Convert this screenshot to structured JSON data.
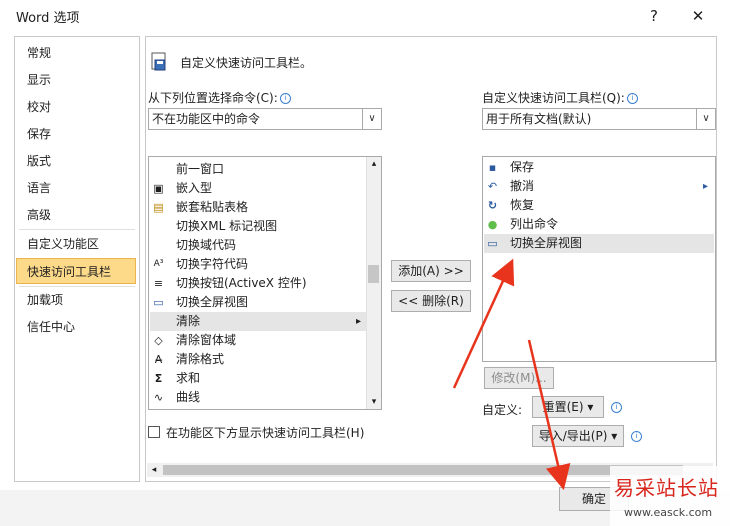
{
  "window": {
    "title": "Word 选项",
    "help_glyph": "?",
    "close_glyph": "✕"
  },
  "nav": {
    "items": [
      {
        "label": "常规"
      },
      {
        "label": "显示"
      },
      {
        "label": "校对"
      },
      {
        "label": "保存"
      },
      {
        "label": "版式"
      },
      {
        "label": "语言"
      },
      {
        "label": "高级"
      },
      {
        "label": "自定义功能区"
      },
      {
        "label": "快速访问工具栏",
        "selected": true
      },
      {
        "label": "加载项"
      },
      {
        "label": "信任中心"
      }
    ]
  },
  "main": {
    "header": "自定义快速访问工具栏。",
    "choose_label": "从下列位置选择命令(C):",
    "choose_value": "不在功能区中的命令",
    "customize_label": "自定义快速访问工具栏(Q):",
    "customize_value": "用于所有文档(默认)",
    "commands": [
      {
        "icon": "window-icon",
        "glyph": "",
        "label": "前一窗口"
      },
      {
        "icon": "inline-icon",
        "glyph": "▣",
        "label": "嵌入型"
      },
      {
        "icon": "nested-paste-icon",
        "glyph": "▤",
        "label": "嵌套粘贴表格"
      },
      {
        "icon": "xml-tags-icon",
        "glyph": "",
        "label": "切换XML 标记视图"
      },
      {
        "icon": "field-codes-icon",
        "glyph": "",
        "label": "切换域代码"
      },
      {
        "icon": "char-code-icon",
        "glyph": "A³",
        "label": "切换字符代码"
      },
      {
        "icon": "activex-icon",
        "glyph": "≡",
        "label": "切换按钮(ActiveX 控件)"
      },
      {
        "icon": "fullscreen-icon",
        "glyph": "▭",
        "label": "切换全屏视图"
      },
      {
        "icon": "clear-icon",
        "glyph": "",
        "label": "清除",
        "has_submenu": true,
        "submenu_glyph": "▸"
      },
      {
        "icon": "eraser-icon",
        "glyph": "◇",
        "label": "清除窗体域"
      },
      {
        "icon": "clear-format-icon",
        "glyph": "A̶",
        "label": "清除格式"
      },
      {
        "icon": "sum-icon",
        "glyph": "Σ",
        "label": "求和"
      },
      {
        "icon": "curve-icon",
        "glyph": "∿",
        "label": "曲线"
      }
    ],
    "toolbar_items": [
      {
        "icon": "save-icon",
        "glyph": "▪",
        "label": "保存"
      },
      {
        "icon": "undo-icon",
        "glyph": "↶",
        "label": "撤消",
        "has_submenu": true,
        "submenu_glyph": "▸"
      },
      {
        "icon": "redo-icon",
        "glyph": "↻",
        "label": "恢复"
      },
      {
        "icon": "list-commands-icon",
        "glyph": "●",
        "label": "列出命令"
      },
      {
        "icon": "fullscreen-icon",
        "glyph": "▭",
        "label": "切换全屏视图",
        "selected": true
      }
    ],
    "add_button": "添加(A) >>",
    "remove_button": "<< 删除(R)",
    "modify_button": "修改(M)...",
    "customize_text": "自定义:",
    "reset_button": "重置(E) ▾",
    "import_export_button": "导入/导出(P) ▾",
    "show_below_label": "在功能区下方显示快速访问工具栏(H)",
    "ok_button": "确定",
    "info_glyph": "i",
    "scroll_up": "▴",
    "scroll_down": "▾",
    "dropdown_glyph": "∨",
    "hscroll_left": "◂"
  },
  "watermark": {
    "text": "易采站长站",
    "url": "www.easck.com"
  },
  "colors": {
    "selected_nav_bg": "#fdd98a",
    "annotation_arrow": "#e8341c"
  }
}
